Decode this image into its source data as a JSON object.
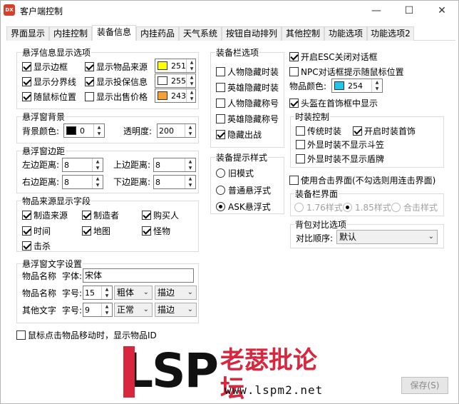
{
  "title": "客户端控制",
  "app_icon_text": "DX",
  "window_controls": {
    "minimize": "—",
    "maximize": "☐",
    "close": "✕"
  },
  "tabs": [
    "界面显示",
    "内挂控制",
    "装备信息",
    "内挂药品",
    "天气系统",
    "按钮自动排列",
    "其他控制",
    "功能选项",
    "功能选项2"
  ],
  "active_tab": "装备信息",
  "hover_info": {
    "title": "悬浮信息显示选项",
    "show_border": "显示边框",
    "show_divider": "显示分界线",
    "follow_mouse": "随鼠标位置",
    "show_item_source": "显示物品来源",
    "show_drop_info": "显示投保信息",
    "show_sell_price": "显示出售价格",
    "color1": {
      "value": "251",
      "hex": "#ffff00"
    },
    "color2": {
      "value": "255",
      "hex": "#ffffff"
    },
    "color3": {
      "value": "243",
      "hex": "#f4a033"
    }
  },
  "hover_bg": {
    "title": "悬浮窗背景",
    "bg_color_label": "背景颜色:",
    "bg_color_value": "0",
    "bg_color_hex": "#000000",
    "opacity_label": "透明度:",
    "opacity_value": "200"
  },
  "hover_margin": {
    "title": "悬浮窗边距",
    "left_label": "左边距离:",
    "left_value": "8",
    "top_label": "上边距离:",
    "top_value": "8",
    "right_label": "右边距离:",
    "right_value": "8",
    "bottom_label": "下边距离:",
    "bottom_value": "8"
  },
  "item_source": {
    "title": "物品来源显示字段",
    "fields": [
      "制造来源",
      "制造者",
      "购买人",
      "时间",
      "地图",
      "怪物",
      "击杀"
    ]
  },
  "hover_text": {
    "title": "悬浮窗文字设置",
    "item_name_label": "物品名称",
    "font_label": "字体:",
    "font_value": "宋体",
    "item_name_label2": "物品名称",
    "size_label": "字号:",
    "item_size": "15",
    "item_weight": "粗体",
    "item_stroke": "描边",
    "other_label": "其他文字",
    "other_size_label": "字号:",
    "other_size": "9",
    "other_weight": "正常",
    "other_stroke": "描边"
  },
  "mouse_click_option": "鼠标点击物品移动时，显示物品ID",
  "equip_bar": {
    "title": "装备栏选项",
    "items": [
      "人物隐藏时装",
      "英雄隐藏时装",
      "人物隐藏称号",
      "英雄隐藏称号",
      "隐藏出战"
    ]
  },
  "equip_tip": {
    "title": "装备提示样式",
    "options": [
      "旧模式",
      "普通悬浮式",
      "ASK悬浮式"
    ]
  },
  "right": {
    "esc_close": "开启ESC关闭对话框",
    "npc_random": "NPC对话框提示随鼠标位置",
    "item_color_label": "物品颜色:",
    "item_color_value": "254",
    "item_color_hex": "#21c7e8",
    "helmet_show": "头盔在首饰框中显示"
  },
  "fashion": {
    "title": "时装控制",
    "traditional": "传统时装",
    "enable_jewelry": "开启时装首饰",
    "hide_hat": "外显时装不显示斗笠",
    "hide_shield": "外显时装不显示盾牌"
  },
  "combo": {
    "use_combo": "使用合击界面(不勾选则用连击界面)",
    "title": "装备栏界面",
    "options": [
      "1.76样式",
      "1.85样式",
      "合击样式"
    ]
  },
  "bag_compare": {
    "title": "背包对比选项",
    "order_label": "对比顺序:",
    "order_value": "默认"
  },
  "save_button": "保存(S)",
  "watermark": {
    "brand": "LSP",
    "cn": "老瑟批论坛",
    "url": "www.lspm2.net"
  }
}
